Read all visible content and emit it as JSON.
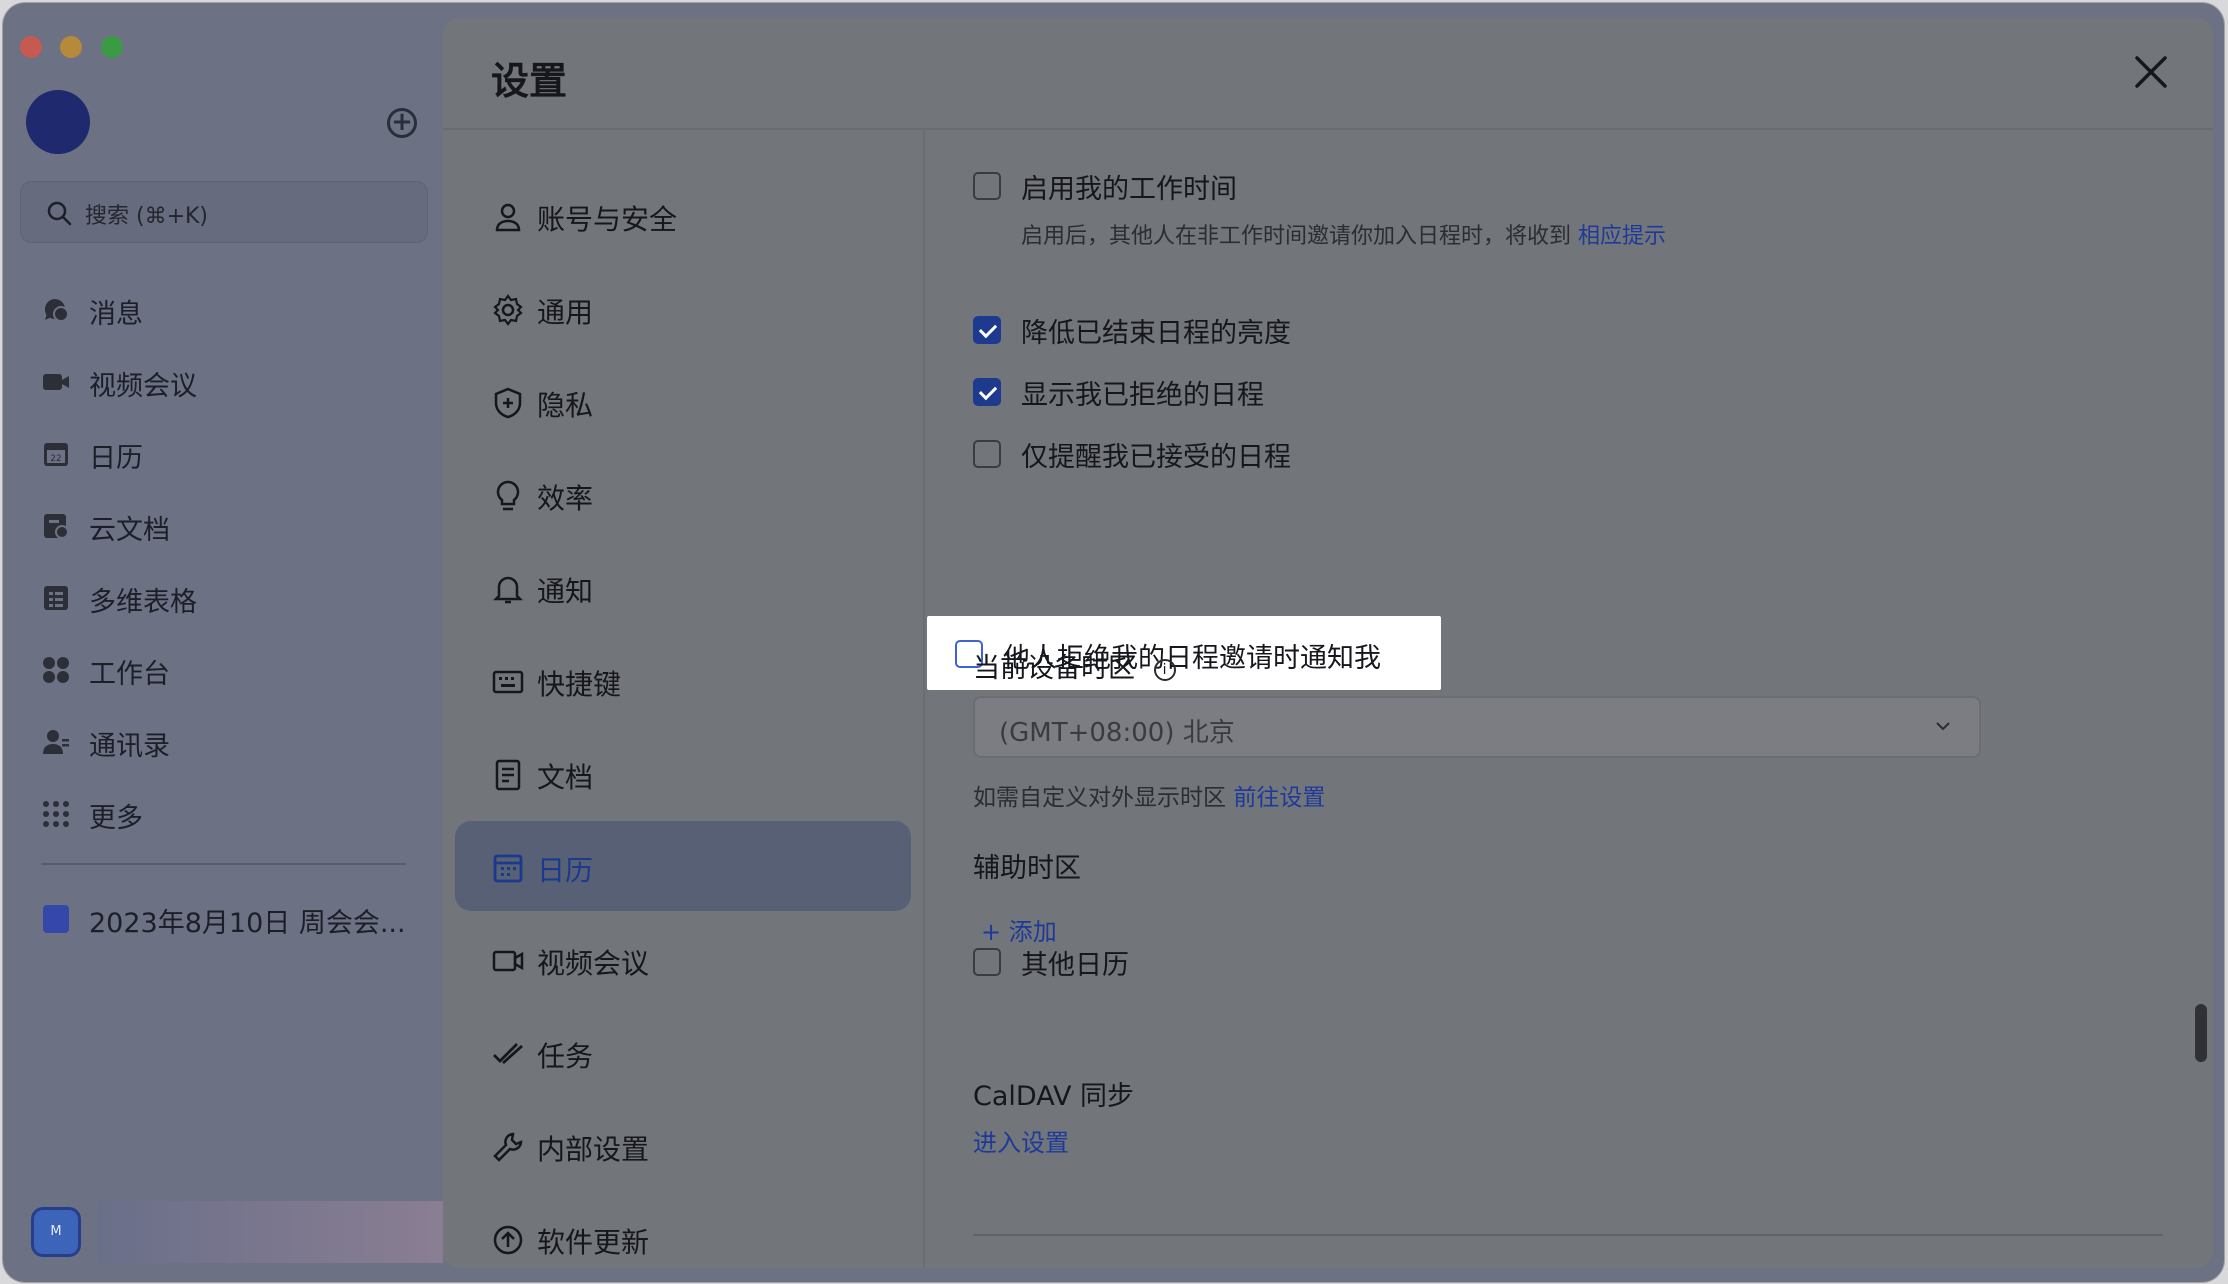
{
  "app": {
    "search_placeholder": "搜索 (⌘+K)",
    "nav": [
      {
        "label": "消息",
        "icon": "chat-bubble-icon"
      },
      {
        "label": "视频会议",
        "icon": "video-camera-icon"
      },
      {
        "label": "日历",
        "icon": "calendar-icon"
      },
      {
        "label": "云文档",
        "icon": "cloud-doc-icon"
      },
      {
        "label": "多维表格",
        "icon": "table-icon"
      },
      {
        "label": "工作台",
        "icon": "grid-apps-icon"
      },
      {
        "label": "通讯录",
        "icon": "contacts-icon"
      },
      {
        "label": "更多",
        "icon": "more-dots-icon"
      }
    ],
    "pinned_doc": "2023年8月10日 周会会...",
    "user_avatar_letter": "M"
  },
  "settings": {
    "title": "设置",
    "nav": [
      {
        "label": "账号与安全",
        "icon": "person-icon"
      },
      {
        "label": "通用",
        "icon": "gear-icon"
      },
      {
        "label": "隐私",
        "icon": "shield-icon"
      },
      {
        "label": "效率",
        "icon": "lightbulb-icon"
      },
      {
        "label": "通知",
        "icon": "bell-icon"
      },
      {
        "label": "快捷键",
        "icon": "keyboard-icon"
      },
      {
        "label": "文档",
        "icon": "document-icon"
      },
      {
        "label": "日历",
        "icon": "calendar-icon",
        "active": true
      },
      {
        "label": "视频会议",
        "icon": "video-camera-icon"
      },
      {
        "label": "任务",
        "icon": "task-check-icon"
      },
      {
        "label": "内部设置",
        "icon": "wrench-icon"
      },
      {
        "label": "软件更新",
        "icon": "update-icon"
      }
    ],
    "calendar": {
      "working_hours": {
        "label": "启用我的工作时间",
        "checked": false
      },
      "working_hours_hint": "启用后，其他人在非工作时间邀请你加入日程时，将收到",
      "working_hours_hint_link": "相应提示",
      "dim_past_events": {
        "label": "降低已结束日程的亮度",
        "checked": true
      },
      "show_declined": {
        "label": "显示我已拒绝的日程",
        "checked": true
      },
      "remind_accepted_only": {
        "label": "仅提醒我已接受的日程",
        "checked": false
      },
      "notify_on_decline": {
        "label": "他人拒绝我的日程邀请时通知我",
        "checked": false
      },
      "timezone_label": "当前设备时区",
      "timezone_value": "(GMT+08:00) 北京",
      "timezone_hint": "如需自定义对外显示时区",
      "timezone_hint_link": "前往设置",
      "secondary_timezone_label": "辅助时区",
      "add_label": "添加",
      "other_calendars": {
        "label": "其他日历",
        "checked": false
      },
      "caldav_label": "CalDAV 同步",
      "caldav_link": "进入设置"
    }
  },
  "colors": {
    "accent": "#1e3a8f",
    "link": "#1d3a9a",
    "active_nav_bg": "#576074"
  }
}
